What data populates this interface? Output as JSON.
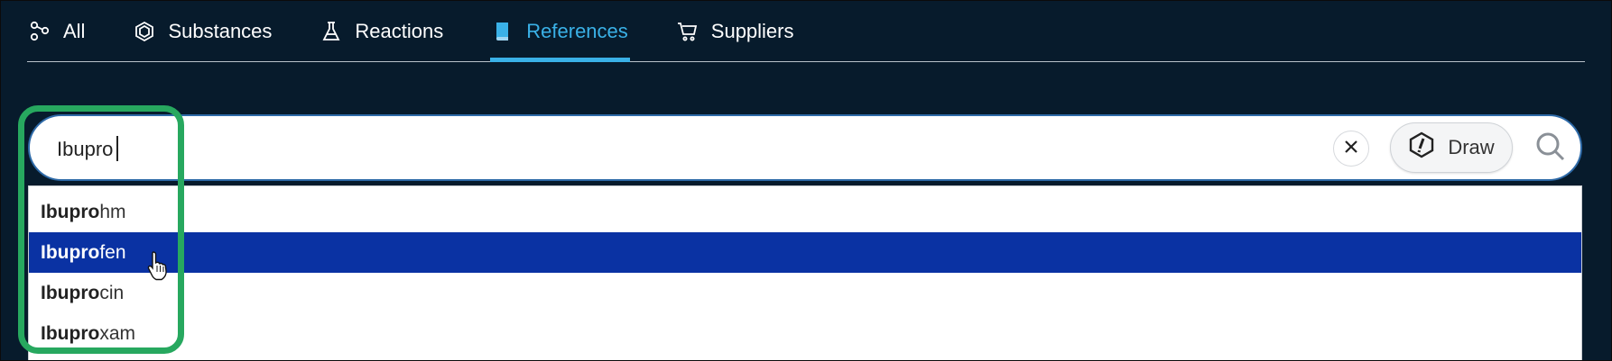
{
  "tabs": [
    {
      "label": "All",
      "icon": "nodes-icon",
      "active": false
    },
    {
      "label": "Substances",
      "icon": "hexagon-icon",
      "active": false
    },
    {
      "label": "Reactions",
      "icon": "flask-icon",
      "active": false
    },
    {
      "label": "References",
      "icon": "book-icon",
      "active": true
    },
    {
      "label": "Suppliers",
      "icon": "cart-icon",
      "active": false
    }
  ],
  "search": {
    "value": "Ibupro",
    "draw_label": "Draw"
  },
  "suggestions": [
    {
      "match": "Ibupro",
      "rest": "hm",
      "highlighted": false
    },
    {
      "match": "Ibupro",
      "rest": "fen",
      "highlighted": true
    },
    {
      "match": "Ibupro",
      "rest": "cin",
      "highlighted": false
    },
    {
      "match": "Ibupro",
      "rest": "xam",
      "highlighted": false
    }
  ],
  "colors": {
    "background": "#071b2c",
    "active_tab": "#3ab1e7",
    "highlight_row": "#0a32a3",
    "callout": "#27a85f"
  }
}
